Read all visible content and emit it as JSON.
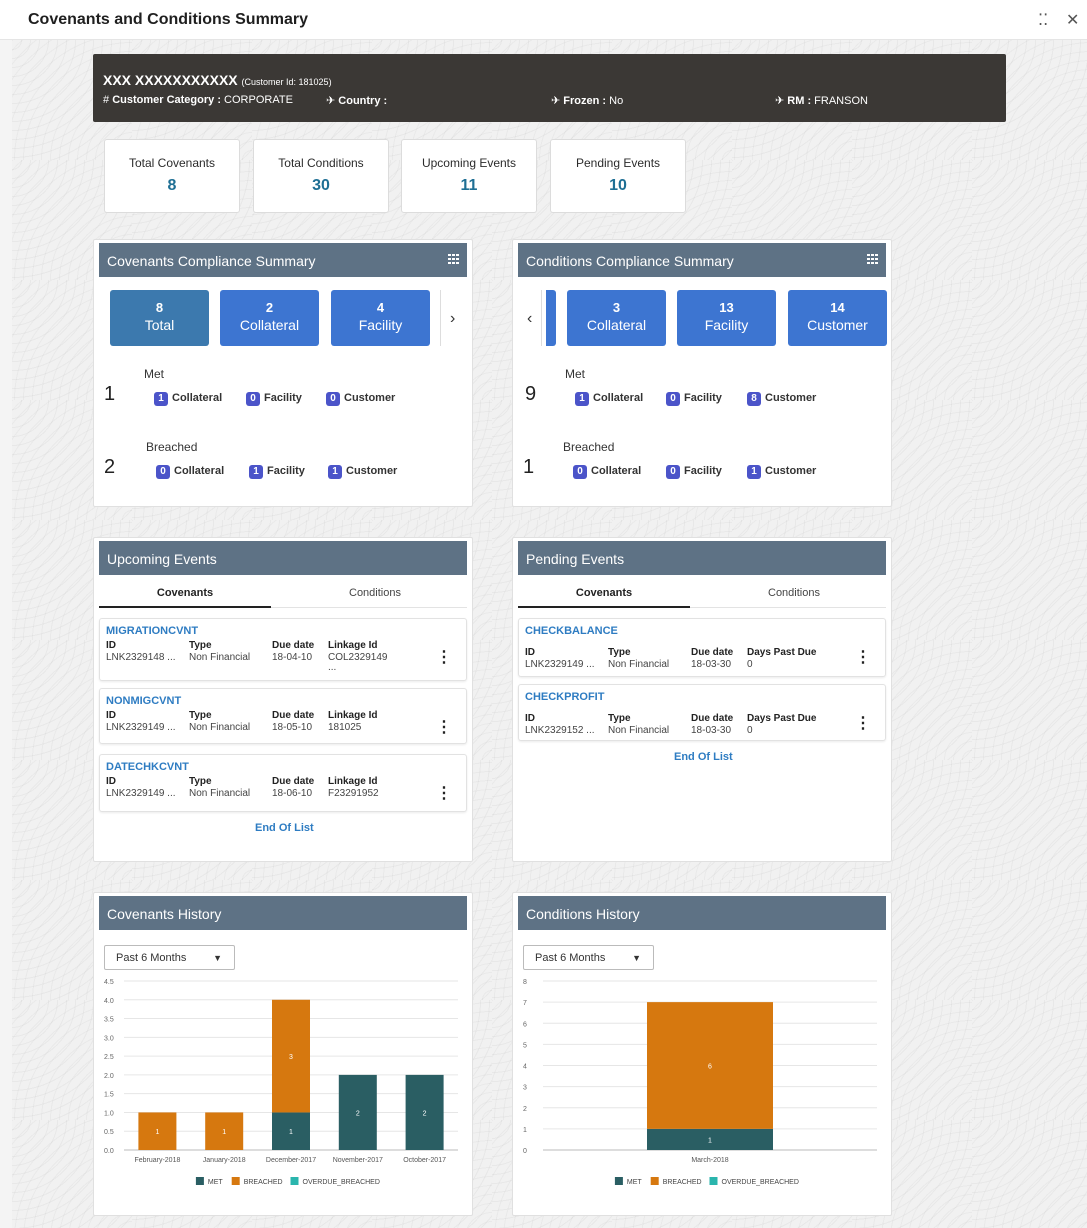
{
  "window": {
    "title": "Covenants and Conditions Summary"
  },
  "customer": {
    "name": "XXX XXXXXXXXXXX",
    "id_label": "(Customer Id: 181025)",
    "category_label": "Customer Category :",
    "category_value": "CORPORATE",
    "country_label": "Country :",
    "country_value": "",
    "frozen_label": "Frozen :",
    "frozen_value": "No",
    "rm_label": "RM :",
    "rm_value": "FRANSON"
  },
  "stats": [
    {
      "label": "Total Covenants",
      "value": "8"
    },
    {
      "label": "Total Conditions",
      "value": "30"
    },
    {
      "label": "Upcoming Events",
      "value": "11"
    },
    {
      "label": "Pending Events",
      "value": "10"
    }
  ],
  "covenants_compliance": {
    "title": "Covenants Compliance Summary",
    "tiles": [
      {
        "count": "8",
        "label": "Total"
      },
      {
        "count": "2",
        "label": "Collateral"
      },
      {
        "count": "4",
        "label": "Facility"
      }
    ],
    "met": {
      "label": "Met",
      "total": "1",
      "collateral": "1",
      "facility": "0",
      "customer": "0"
    },
    "breached": {
      "label": "Breached",
      "total": "2",
      "collateral": "0",
      "facility": "1",
      "customer": "1"
    }
  },
  "conditions_compliance": {
    "title": "Conditions Compliance Summary",
    "tiles": [
      {
        "count": "3",
        "label": "Collateral"
      },
      {
        "count": "13",
        "label": "Facility"
      },
      {
        "count": "14",
        "label": "Customer"
      }
    ],
    "met": {
      "label": "Met",
      "total": "9",
      "collateral": "1",
      "facility": "0",
      "customer": "8"
    },
    "breached": {
      "label": "Breached",
      "total": "1",
      "collateral": "0",
      "facility": "0",
      "customer": "1"
    }
  },
  "chip_labels": {
    "collateral": "Collateral",
    "facility": "Facility",
    "customer": "Customer"
  },
  "upcoming_events": {
    "title": "Upcoming Events",
    "tabs": [
      "Covenants",
      "Conditions"
    ],
    "headers": {
      "id": "ID",
      "type": "Type",
      "due": "Due date",
      "fourth": "Linkage Id"
    },
    "items": [
      {
        "name": "MIGRATIONCVNT",
        "id": "LNK2329148 ...",
        "type": "Non Financial",
        "due": "18-04-10",
        "fourth": "COL2329149",
        "extra": "..."
      },
      {
        "name": "NONMIGCVNT",
        "id": "LNK2329149 ...",
        "type": "Non Financial",
        "due": "18-05-10",
        "fourth": "181025",
        "extra": ""
      },
      {
        "name": "DATECHKCVNT",
        "id": "LNK2329149 ...",
        "type": "Non Financial",
        "due": "18-06-10",
        "fourth": "F23291952",
        "extra": ""
      }
    ],
    "end_label": "End Of List"
  },
  "pending_events": {
    "title": "Pending Events",
    "tabs": [
      "Covenants",
      "Conditions"
    ],
    "headers": {
      "id": "ID",
      "type": "Type",
      "due": "Due date",
      "fourth": "Days Past Due"
    },
    "items": [
      {
        "name": "CHECKBALANCE",
        "id": "LNK2329149 ...",
        "type": "Non Financial",
        "due": "18-03-30",
        "fourth": "0"
      },
      {
        "name": "CHECKPROFIT",
        "id": "LNK2329152 ...",
        "type": "Non Financial",
        "due": "18-03-30",
        "fourth": "0"
      }
    ],
    "end_label": "End Of List"
  },
  "covenants_history": {
    "title": "Covenants History",
    "period": "Past 6 Months"
  },
  "conditions_history": {
    "title": "Conditions History",
    "period": "Past 6 Months"
  },
  "colors": {
    "met": "#2a5e63",
    "breached": "#d6780f",
    "overdue_breached": "#2ab5ad",
    "header": "#5e7285",
    "tile": "#3d75d1"
  },
  "chart_data": [
    {
      "type": "bar",
      "stacked": true,
      "categories": [
        "February-2018",
        "January-2018",
        "December-2017",
        "November-2017",
        "October-2017"
      ],
      "series": [
        {
          "name": "MET",
          "values": [
            0,
            0,
            1,
            2,
            2
          ]
        },
        {
          "name": "BREACHED",
          "values": [
            1,
            1,
            3,
            0,
            0
          ]
        },
        {
          "name": "OVERDUE_BREACHED",
          "values": [
            0,
            0,
            0,
            0,
            0
          ]
        }
      ],
      "yticks": [
        "0.0",
        "0.5",
        "1.0",
        "1.5",
        "2.0",
        "2.5",
        "3.0",
        "3.5",
        "4.0",
        "4.5"
      ],
      "ylim": [
        0,
        4.5
      ],
      "legend": "bottom"
    },
    {
      "type": "bar",
      "stacked": true,
      "categories": [
        "March-2018"
      ],
      "series": [
        {
          "name": "MET",
          "values": [
            1
          ]
        },
        {
          "name": "BREACHED",
          "values": [
            6
          ]
        },
        {
          "name": "OVERDUE_BREACHED",
          "values": [
            0
          ]
        }
      ],
      "yticks": [
        "0",
        "1",
        "2",
        "3",
        "4",
        "5",
        "6",
        "7",
        "8"
      ],
      "ylim": [
        0,
        8
      ],
      "legend": "bottom"
    }
  ]
}
